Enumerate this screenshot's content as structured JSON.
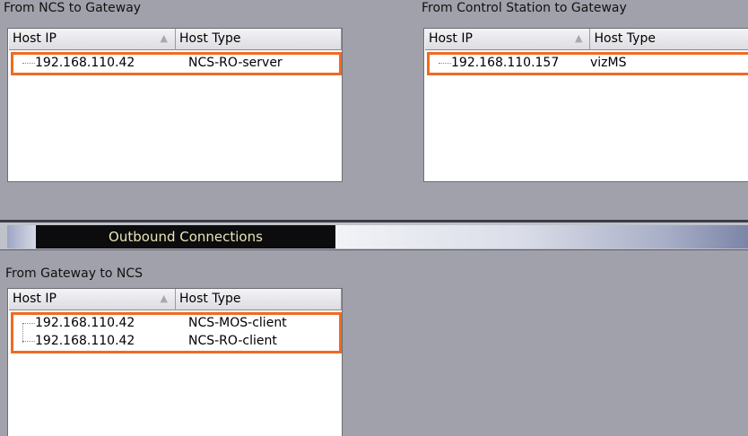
{
  "inbound": {
    "ncs_to_gateway": {
      "title": "From NCS to Gateway",
      "columns": {
        "host_ip": "Host IP",
        "host_type": "Host Type"
      },
      "rows": [
        {
          "ip": "192.168.110.42",
          "type": "NCS-RO-server"
        }
      ]
    },
    "control_to_gateway": {
      "title": "From Control Station to Gateway",
      "columns": {
        "host_ip": "Host IP",
        "host_type": "Host Type"
      },
      "rows": [
        {
          "ip": "192.168.110.157",
          "type": "vizMS"
        }
      ]
    }
  },
  "outbound": {
    "title": "Outbound Connections",
    "gateway_to_ncs": {
      "title": "From Gateway to NCS",
      "columns": {
        "host_ip": "Host IP",
        "host_type": "Host Type"
      },
      "rows": [
        {
          "ip": "192.168.110.42",
          "type": "NCS-MOS-client"
        },
        {
          "ip": "192.168.110.42",
          "type": "NCS-RO-client"
        }
      ]
    }
  },
  "icons": {
    "sort": "sort-ascending-icon"
  },
  "colors": {
    "highlight": "#ef6a24",
    "background": "#a1a1ab",
    "band_tab": "#0c0c0e"
  }
}
